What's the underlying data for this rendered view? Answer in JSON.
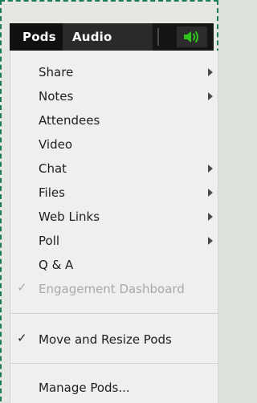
{
  "menubar": {
    "pods_label": "Pods",
    "audio_label": "Audio",
    "speaker_icon": "speaker-icon",
    "speaker_color": "#2ec51a"
  },
  "menu": {
    "items": [
      {
        "label": "Share",
        "has_submenu": true,
        "checked": false,
        "enabled": true
      },
      {
        "label": "Notes",
        "has_submenu": true,
        "checked": false,
        "enabled": true
      },
      {
        "label": "Attendees",
        "has_submenu": false,
        "checked": false,
        "enabled": true
      },
      {
        "label": "Video",
        "has_submenu": false,
        "checked": false,
        "enabled": true
      },
      {
        "label": "Chat",
        "has_submenu": true,
        "checked": false,
        "enabled": true
      },
      {
        "label": "Files",
        "has_submenu": true,
        "checked": false,
        "enabled": true
      },
      {
        "label": "Web Links",
        "has_submenu": true,
        "checked": false,
        "enabled": true
      },
      {
        "label": "Poll",
        "has_submenu": true,
        "checked": false,
        "enabled": true
      },
      {
        "label": "Q & A",
        "has_submenu": false,
        "checked": false,
        "enabled": true
      },
      {
        "label": "Engagement Dashboard",
        "has_submenu": false,
        "checked": true,
        "enabled": false
      },
      {
        "label": "Move and Resize Pods",
        "has_submenu": false,
        "checked": true,
        "enabled": true
      },
      {
        "label": "Manage Pods...",
        "has_submenu": false,
        "checked": false,
        "enabled": true
      }
    ],
    "check_glyph": "✓"
  }
}
